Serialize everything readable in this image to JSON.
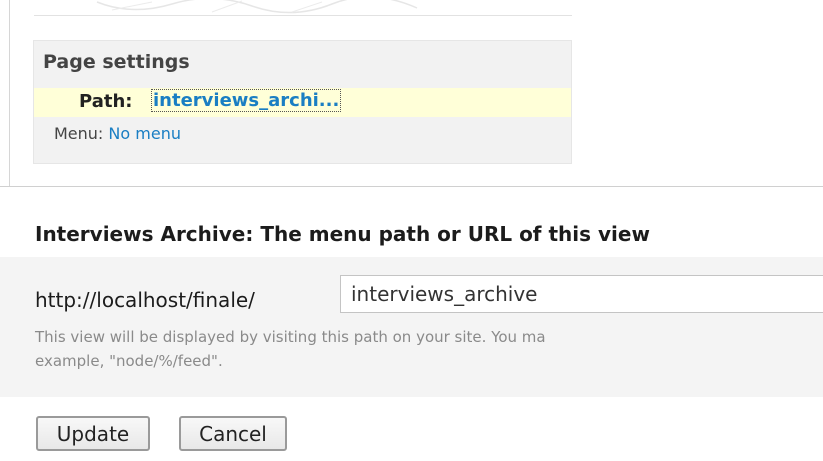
{
  "page_settings": {
    "title": "Page settings",
    "path_label": "Path:",
    "path_value": "interviews_archi...",
    "menu_label": "Menu:",
    "menu_value": "No menu"
  },
  "form": {
    "title": "Interviews Archive: The menu path or URL of this view",
    "url_prefix": "http://localhost/finale/",
    "path_input_value": "interviews_archive",
    "help_line_1": "This view will be displayed by visiting this path on your site. You ma",
    "help_line_2": "example, \"node/%/feed\".",
    "update_label": "Update",
    "cancel_label": "Cancel"
  },
  "colors": {
    "link": "#1a7ec3",
    "highlight_row": "#ffffd8",
    "panel_bg": "#f2f2f2"
  }
}
